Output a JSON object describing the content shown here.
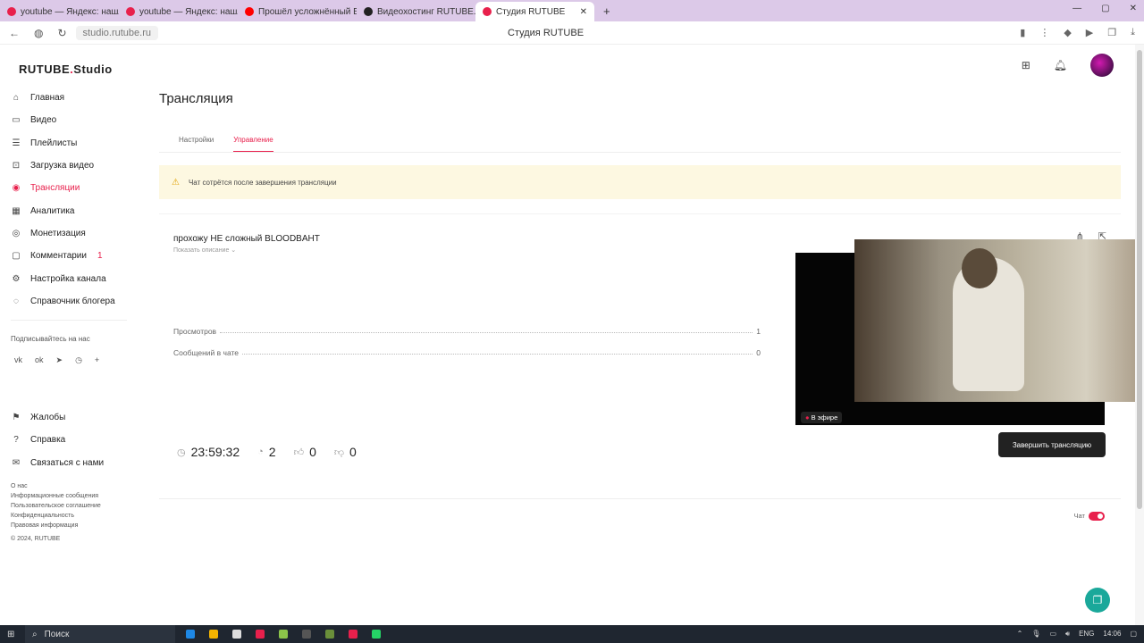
{
  "browser": {
    "tabs": [
      {
        "label": "youtube — Яндекс: нашл",
        "color": "#e8204c"
      },
      {
        "label": "youtube — Яндекс: нашл",
        "color": "#e8204c"
      },
      {
        "label": "Прошёл усложнённый Bl",
        "color": "#ff0000"
      },
      {
        "label": "Видеохостинг RUTUBE. С",
        "color": "#222222"
      },
      {
        "label": "Студия RUTUBE",
        "color": "#e8204c",
        "active": true
      }
    ],
    "url": "studio.rutube.ru",
    "page_title": "Студия RUTUBE"
  },
  "logo": {
    "main": "RUTUBE",
    "suffix": "Studio"
  },
  "sidebar": {
    "items": [
      {
        "label": "Главная",
        "icon": "home-icon",
        "glyph": "⌂"
      },
      {
        "label": "Видео",
        "icon": "video-icon",
        "glyph": "▭"
      },
      {
        "label": "Плейлисты",
        "icon": "playlist-icon",
        "glyph": "☰"
      },
      {
        "label": "Загрузка видео",
        "icon": "upload-icon",
        "glyph": "⊡"
      },
      {
        "label": "Трансляции",
        "icon": "broadcast-icon",
        "glyph": "◉",
        "active": true
      },
      {
        "label": "Аналитика",
        "icon": "analytics-icon",
        "glyph": "▦"
      },
      {
        "label": "Монетизация",
        "icon": "monetization-icon",
        "glyph": "◎"
      },
      {
        "label": "Комментарии",
        "icon": "comments-icon",
        "glyph": "▢",
        "badge": "1"
      },
      {
        "label": "Настройка канала",
        "icon": "settings-icon",
        "glyph": "⚙"
      },
      {
        "label": "Справочник блогера",
        "icon": "handbook-icon",
        "glyph": "◌"
      }
    ],
    "follow_label": "Подписывайтесь на нас",
    "socials": [
      "vk",
      "ok",
      "tg",
      "viber",
      "+"
    ],
    "items2": [
      {
        "label": "Жалобы",
        "icon": "flag-icon",
        "glyph": "⚑"
      },
      {
        "label": "Справка",
        "icon": "help-icon",
        "glyph": "?"
      },
      {
        "label": "Связаться с нами",
        "icon": "mail-icon",
        "glyph": "✉"
      }
    ],
    "footer": [
      "О нас",
      "Информационные сообщения",
      "Пользовательское соглашение",
      "Конфиденциальность",
      "Правовая информация",
      "© 2024, RUTUBE"
    ]
  },
  "main": {
    "title": "Трансляция",
    "tabs": [
      "Настройки",
      "Управление"
    ],
    "warning": "Чат сотрётся после завершения трансляции",
    "stream": {
      "title": "прохожу НЕ сложный BLOODBAHT",
      "show_desc": "Показать описание",
      "stats": [
        {
          "label": "Просмотров",
          "value": "1"
        },
        {
          "label": "Сообщений в чате",
          "value": "0"
        }
      ],
      "duration": "23:59:32",
      "viewers": "2",
      "likes": "0",
      "dislikes": "0",
      "live_label": "В эфире",
      "end_button": "Завершить трансляцию"
    },
    "chat_label": "Чат"
  },
  "taskbar": {
    "search": "Поиск",
    "lang": "ENG",
    "time": "14:06"
  }
}
